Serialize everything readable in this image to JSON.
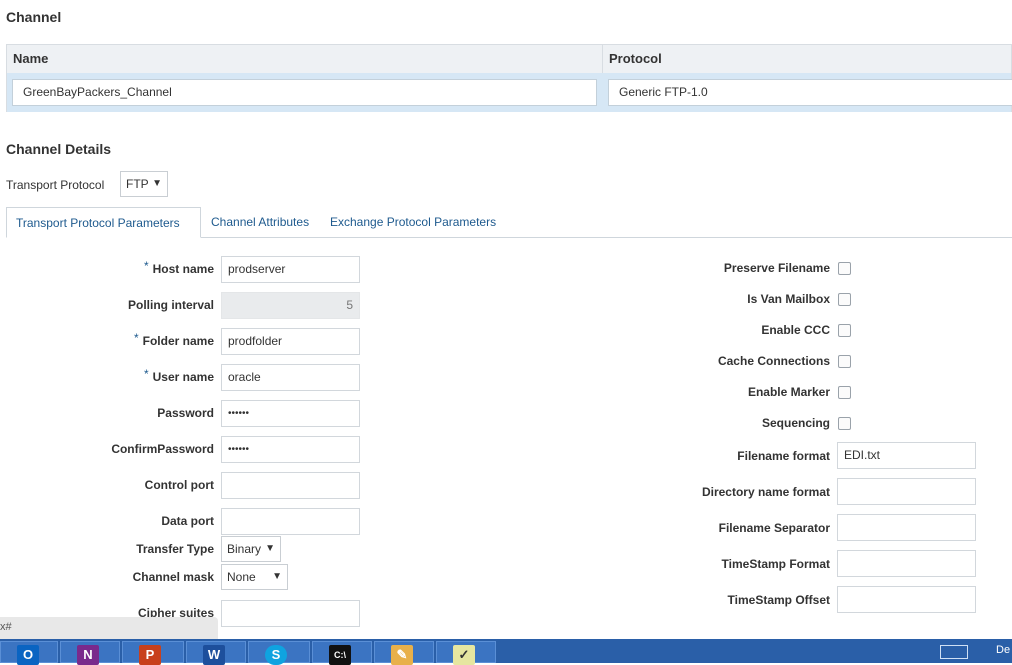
{
  "channel": {
    "title": "Channel",
    "col_name": "Name",
    "col_protocol": "Protocol",
    "name_value": "GreenBayPackers_Channel",
    "protocol_value": "Generic FTP-1.0"
  },
  "details": {
    "title": "Channel Details",
    "transport_label": "Transport Protocol",
    "transport_value": "FTP"
  },
  "tabs": [
    {
      "label": "Transport Protocol Parameters",
      "active": true
    },
    {
      "label": "Channel Attributes",
      "active": false
    },
    {
      "label": "Exchange Protocol Parameters",
      "active": false
    }
  ],
  "left_fields": {
    "host_label": "Host name",
    "host_value": "prodserver",
    "polling_label": "Polling interval",
    "polling_value": "5",
    "folder_label": "Folder name",
    "folder_value": "prodfolder",
    "user_label": "User name",
    "user_value": "oracle",
    "password_label": "Password",
    "password_value": "••••••",
    "confirm_label": "ConfirmPassword",
    "confirm_value": "••••••",
    "control_port_label": "Control port",
    "control_port_value": "",
    "data_port_label": "Data port",
    "data_port_value": "",
    "transfer_label": "Transfer Type",
    "transfer_value": "Binary",
    "mask_label": "Channel mask",
    "mask_value": "None",
    "cipher_label": "Cipher suites",
    "cipher_value": ""
  },
  "right_fields": {
    "preserve_label": "Preserve Filename",
    "van_label": "Is Van Mailbox",
    "ccc_label": "Enable CCC",
    "cache_label": "Cache Connections",
    "marker_label": "Enable Marker",
    "seq_label": "Sequencing",
    "filename_format_label": "Filename format",
    "filename_format_value": "EDI.txt",
    "dir_format_label": "Directory name format",
    "dir_format_value": "",
    "separator_label": "Filename Separator",
    "separator_value": "",
    "ts_format_label": "TimeStamp Format",
    "ts_format_value": "",
    "ts_offset_label": "TimeStamp Offset",
    "ts_offset_value": ""
  },
  "taskbar": {
    "tooltip": "x#",
    "apps": [
      "outlook-icon",
      "onenote-icon",
      "powerpoint-icon",
      "word-icon",
      "skype-icon",
      "cmd-icon",
      "paint-icon",
      "notepad-icon"
    ],
    "tray_text": "De"
  },
  "colors": {
    "accent": "#1e5a8e",
    "header_bg": "#eef1f4",
    "row_selected": "#d6e7f5",
    "taskbar": "#2a5fa8"
  }
}
